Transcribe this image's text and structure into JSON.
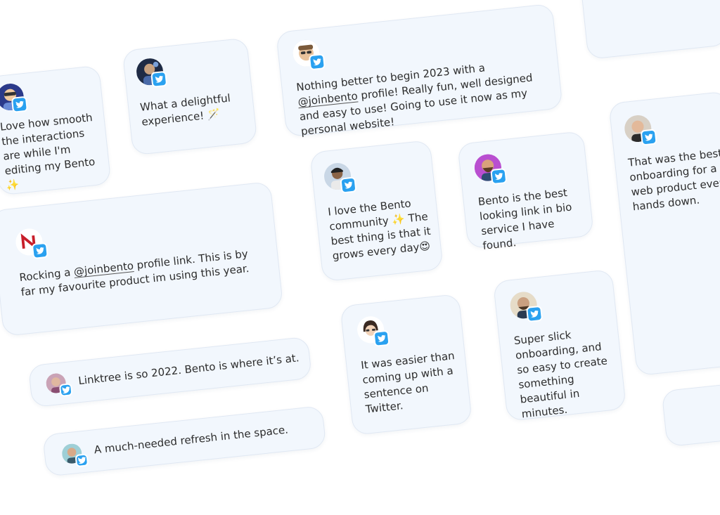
{
  "testimonials": {
    "t1": {
      "before": "Love how smooth the interactions are while I'm editing my Bento",
      "emoji": "✨"
    },
    "t2": {
      "before": "What a delightful experience!",
      "emoji": "🪄"
    },
    "t3": {
      "before": "Nothing better to begin 2023 with a",
      "mention": "@joinbento",
      "after": "profile! Really fun, well designed and easy to use! Going to use it now as my personal website!"
    },
    "t4": {
      "before": "Rocking a",
      "mention": "@joinbento",
      "after": "profile link. This is by far my favourite product im using this year."
    },
    "t5": {
      "before": "I love the Bento community",
      "emoji": "✨",
      "after": "The best thing is that it grows every day",
      "emoji2": "😍"
    },
    "t6": {
      "text": "Bento is the best looking link in bio service I have found."
    },
    "t7": {
      "text": "That was the best onboarding for a web product ever, hands down."
    },
    "t8": {
      "text": "Linktree is so 2022. Bento is where it’s at."
    },
    "t9": {
      "text": "It was easier than coming up with a sentence on Twitter."
    },
    "t10": {
      "text": "Super slick onboarding, and so easy to create something beautiful in minutes."
    },
    "t11": {
      "text": "A much-needed refresh in the space."
    }
  },
  "colors": {
    "card_bg": "#f2f7fd",
    "twitter": "#2aa1f0",
    "text": "#2c2c2c"
  },
  "icons": [
    "twitter-icon",
    "avatar"
  ]
}
